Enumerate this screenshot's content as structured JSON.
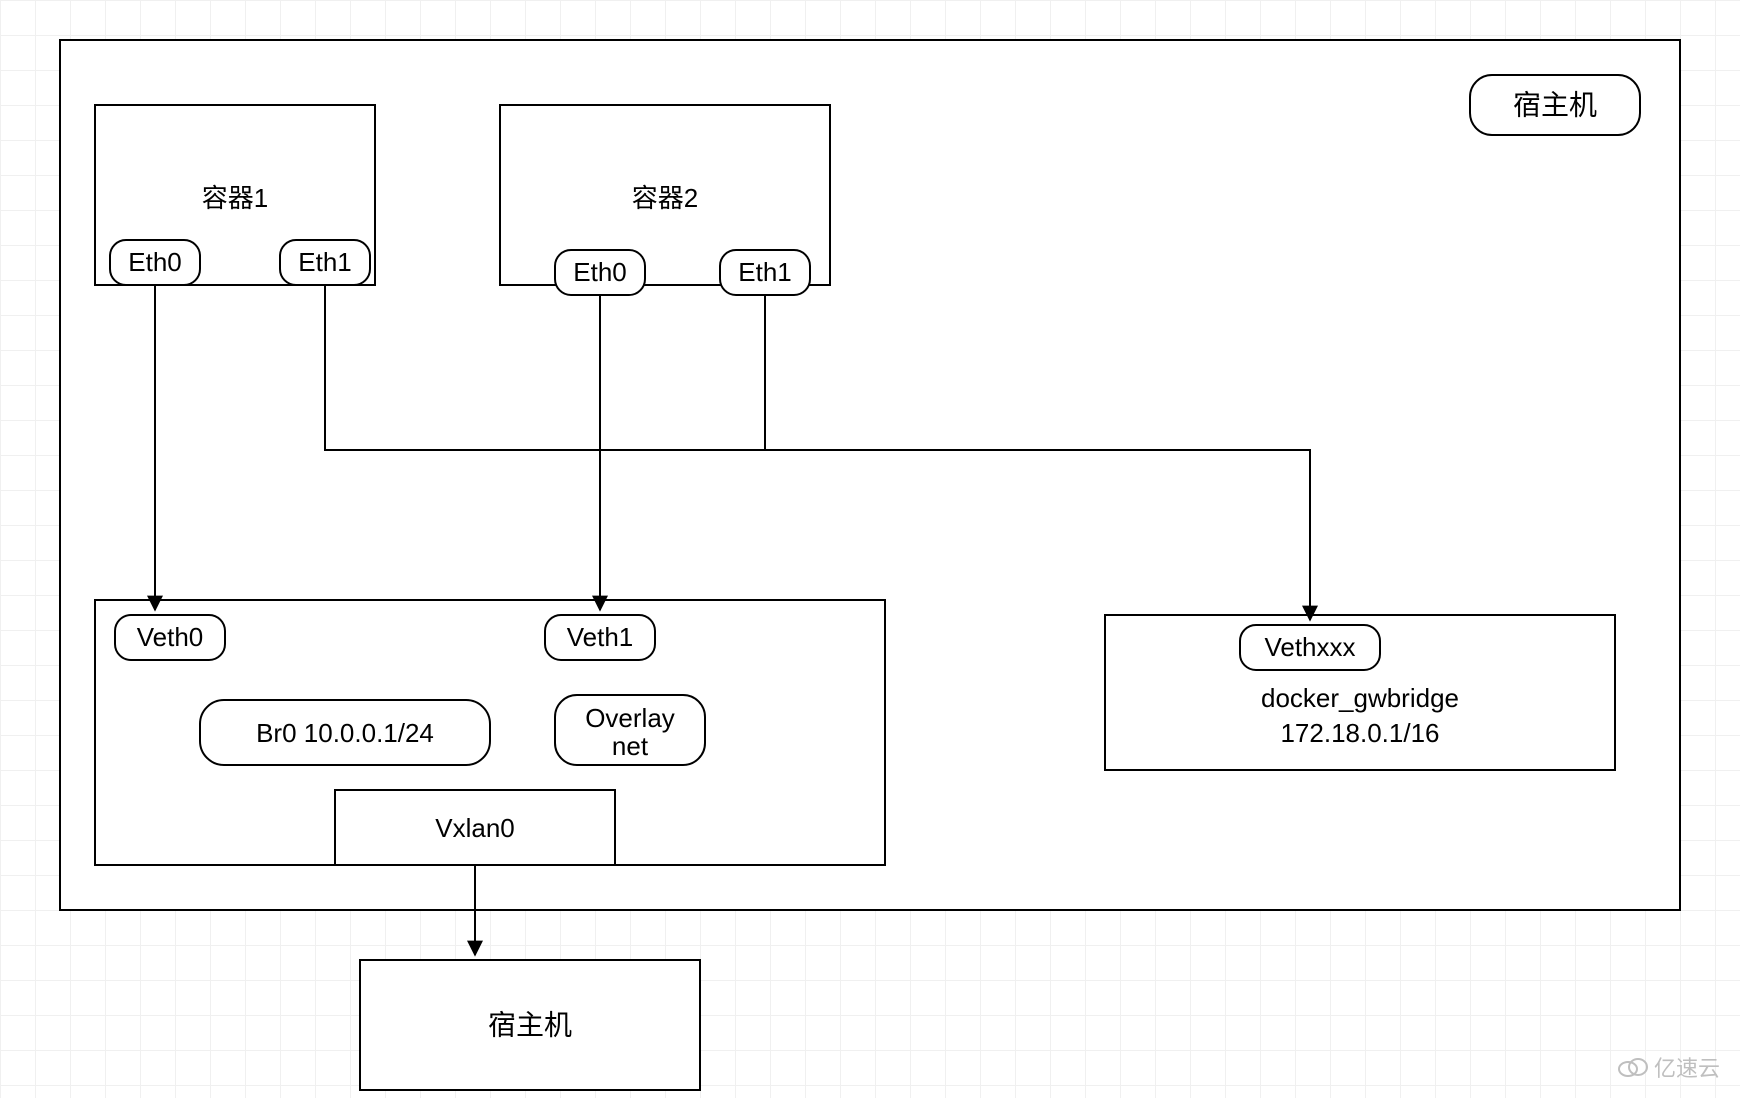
{
  "diagram": {
    "host_label_top": "宿主机",
    "host_label_bottom": "宿主机",
    "container1": {
      "title": "容器1",
      "eth0": "Eth0",
      "eth1": "Eth1"
    },
    "container2": {
      "title": "容器2",
      "eth0": "Eth0",
      "eth1": "Eth1"
    },
    "overlay_box": {
      "veth0": "Veth0",
      "veth1": "Veth1",
      "br0": "Br0 10.0.0.1/24",
      "overlay_net_line1": "Overlay",
      "overlay_net_line2": "net",
      "vxlan0": "Vxlan0"
    },
    "gwbridge_box": {
      "vethxxx": "Vethxxx",
      "name": "docker_gwbridge",
      "cidr": "172.18.0.1/16"
    }
  },
  "watermark": "亿速云"
}
